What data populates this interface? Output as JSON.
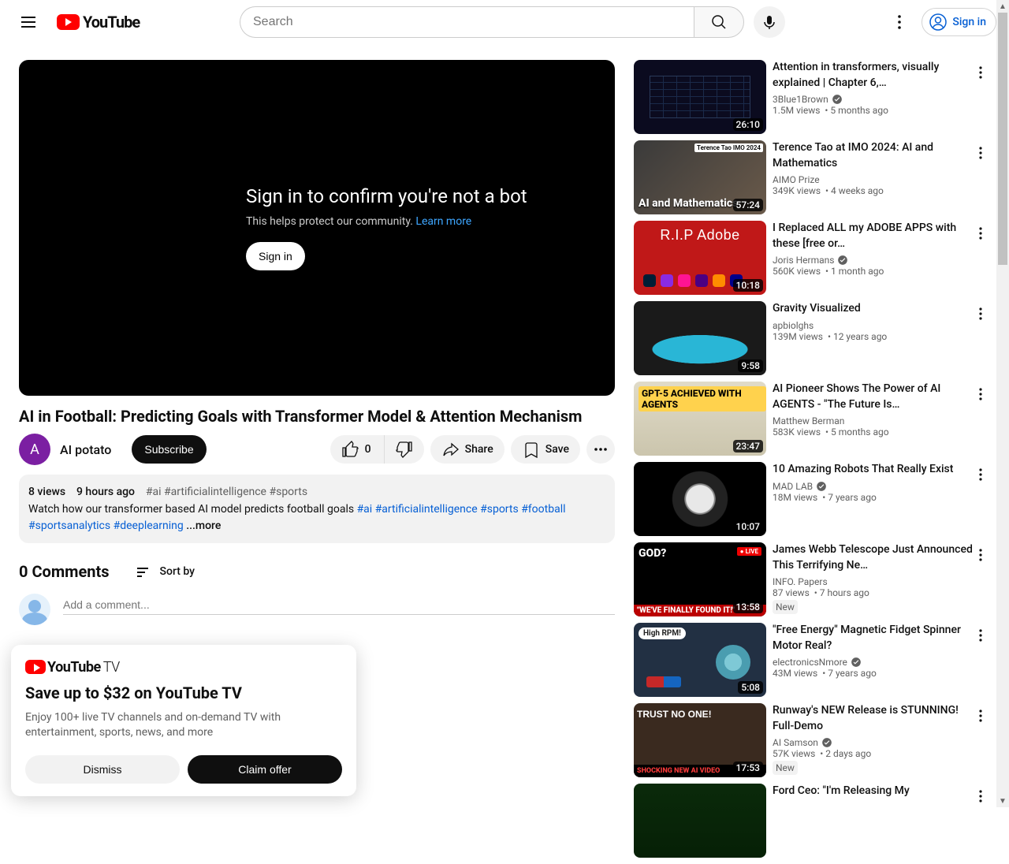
{
  "header": {
    "search_placeholder": "Search",
    "signin_label": "Sign in",
    "logo_text": "YouTube"
  },
  "player": {
    "headline": "Sign in to confirm you're not a bot",
    "subtext": "This helps protect our community.",
    "learn_more": "Learn more",
    "signin_btn": "Sign in"
  },
  "video": {
    "title": "AI in Football: Predicting Goals with Transformer Model & Attention Mechanism",
    "channel_initial": "A",
    "channel_name": "AI potato",
    "subscribe_label": "Subscribe",
    "like_count": "0",
    "share_label": "Share",
    "save_label": "Save"
  },
  "description": {
    "views": "8 views",
    "age": "9 hours ago",
    "meta_tags": [
      "#ai",
      "#artificialintelligence",
      "#sports"
    ],
    "body_prefix": "Watch how our transformer based AI model predicts football goals ",
    "body_tags": [
      "#ai",
      "#artificialintelligence",
      "#sports",
      "#football",
      "#sportsanalytics",
      "#deeplearning"
    ],
    "more_label": " ...more"
  },
  "comments": {
    "count_label": "0 Comments",
    "sort_label": "Sort by",
    "placeholder": "Add a comment..."
  },
  "promo": {
    "logo_text": "YouTube",
    "logo_suffix": "TV",
    "headline": "Save up to $32 on YouTube TV",
    "body": "Enjoy 100+ live TV channels and on-demand TV with entertainment, sports, news, and more",
    "dismiss": "Dismiss",
    "claim": "Claim offer"
  },
  "recommendations": [
    {
      "title": "Attention in transformers, visually explained | Chapter 6,…",
      "channel": "3Blue1Brown",
      "verified": true,
      "views": "1.5M views",
      "age": "5 months ago",
      "duration": "26:10",
      "thumb": "th0",
      "badge": null,
      "decor": null
    },
    {
      "title": "Terence Tao at IMO 2024: AI and Mathematics",
      "channel": "AIMO Prize",
      "verified": false,
      "views": "349K views",
      "age": "4 weeks ago",
      "duration": "57:24",
      "thumb": "th1",
      "badge": null,
      "decor": "tao"
    },
    {
      "title": "I Replaced ALL my ADOBE APPS with these [free or…",
      "channel": "Joris Hermans",
      "verified": true,
      "views": "560K views",
      "age": "1 month ago",
      "duration": "10:18",
      "thumb": "th2",
      "badge": null,
      "decor": "adobe"
    },
    {
      "title": "Gravity Visualized",
      "channel": "apbiolghs",
      "verified": false,
      "views": "139M views",
      "age": "12 years ago",
      "duration": "9:58",
      "thumb": "th3",
      "badge": null,
      "decor": null
    },
    {
      "title": "AI Pioneer Shows The Power of AI AGENTS - \"The Future Is…",
      "channel": "Matthew Berman",
      "verified": false,
      "views": "583K views",
      "age": "5 months ago",
      "duration": "23:47",
      "thumb": "th4",
      "badge": null,
      "decor": "gpt5"
    },
    {
      "title": "10 Amazing Robots That Really Exist",
      "channel": "MAD LAB",
      "verified": true,
      "views": "18M views",
      "age": "7 years ago",
      "duration": "10:07",
      "thumb": "th5",
      "badge": null,
      "decor": null
    },
    {
      "title": "James Webb Telescope Just Announced This Terrifying Ne…",
      "channel": "INFO. Papers",
      "verified": false,
      "views": "87 views",
      "age": "7 hours ago",
      "duration": "13:58",
      "thumb": "th6",
      "badge": "New",
      "decor": "jwst"
    },
    {
      "title": "\"Free Energy\" Magnetic Fidget Spinner Motor Real?",
      "channel": "electronicsNmore",
      "verified": true,
      "views": "43M views",
      "age": "7 years ago",
      "duration": "5:08",
      "thumb": "th7",
      "badge": null,
      "decor": "spinner"
    },
    {
      "title": "Runway's NEW Release is STUNNING! Full-Demo",
      "channel": "AI Samson",
      "verified": true,
      "views": "57K views",
      "age": "2 days ago",
      "duration": "17:53",
      "thumb": "th8",
      "badge": "New",
      "decor": "runway"
    },
    {
      "title": "Ford Ceo: \"I'm Releasing My",
      "channel": "",
      "verified": false,
      "views": "",
      "age": "",
      "duration": "",
      "thumb": "th9",
      "badge": null,
      "decor": null
    }
  ],
  "thumb_text": {
    "tao_label": "AI and\nMathematics",
    "tao_tag": "Terence Tao\nIMO 2024",
    "adobe_rip": "R.I.P Adobe",
    "gpt5_badge": "GPT-5\nACHIEVED WITH\nAGENTS",
    "jwst_god": "GOD?",
    "jwst_bar": "\"WE'VE FINALLY FOUND IT!\"",
    "jwst_live": "● LIVE",
    "spinner_tag": "High RPM!",
    "runway_trust": "TRUST\nNO ONE!",
    "runway_bar": "SHOCKING NEW AI VIDEO"
  }
}
